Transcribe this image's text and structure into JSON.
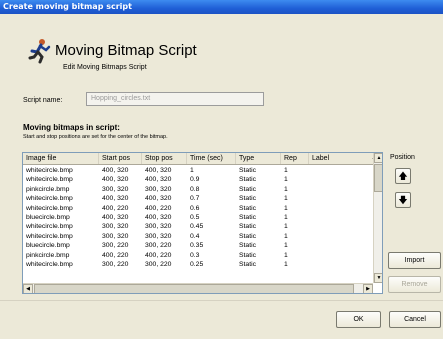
{
  "window": {
    "title": "Create moving bitmap script"
  },
  "header": {
    "title": "Moving Bitmap Script",
    "subtitle": "Edit Moving Bitmaps Script"
  },
  "script": {
    "label": "Script name:",
    "value": "Hopping_circles.txt"
  },
  "bitmaps": {
    "title": "Moving bitmaps in script:",
    "note": "Start and stop positions are set for the center of the bitmap.",
    "columns": [
      "Image file",
      "Start pos",
      "Stop pos",
      "Time (sec)",
      "Type",
      "Rep",
      "Label"
    ],
    "rows": [
      [
        "whitecircle.bmp",
        "400, 320",
        "400, 320",
        "1",
        "Static",
        "1",
        ""
      ],
      [
        "whitecircle.bmp",
        "400, 320",
        "400, 320",
        "0.9",
        "Static",
        "1",
        ""
      ],
      [
        "pinkcircle.bmp",
        "300, 320",
        "300, 320",
        "0.8",
        "Static",
        "1",
        ""
      ],
      [
        "whitecircle.bmp",
        "400, 320",
        "400, 320",
        "0.7",
        "Static",
        "1",
        ""
      ],
      [
        "whitecircle.bmp",
        "400, 220",
        "400, 220",
        "0.6",
        "Static",
        "1",
        ""
      ],
      [
        "bluecircle.bmp",
        "400, 320",
        "400, 320",
        "0.5",
        "Static",
        "1",
        ""
      ],
      [
        "whitecircle.bmp",
        "300, 320",
        "300, 320",
        "0.45",
        "Static",
        "1",
        ""
      ],
      [
        "whitecircle.bmp",
        "300, 320",
        "300, 320",
        "0.4",
        "Static",
        "1",
        ""
      ],
      [
        "bluecircle.bmp",
        "300, 220",
        "300, 220",
        "0.35",
        "Static",
        "1",
        ""
      ],
      [
        "pinkcircle.bmp",
        "400, 220",
        "400, 220",
        "0.3",
        "Static",
        "1",
        ""
      ],
      [
        "whitecircle.bmp",
        "300, 220",
        "300, 220",
        "0.25",
        "Static",
        "1",
        ""
      ]
    ]
  },
  "side": {
    "position_label": "Position",
    "up_icon": "arrow-up-icon",
    "down_icon": "arrow-down-icon",
    "import_label": "Import",
    "remove_label": "Remove"
  },
  "footer": {
    "ok_label": "OK",
    "cancel_label": "Cancel"
  },
  "colors": {
    "titlebar": "#1f5fd6",
    "dialog_bg": "#ece9d8",
    "list_border": "#7f9db9"
  }
}
